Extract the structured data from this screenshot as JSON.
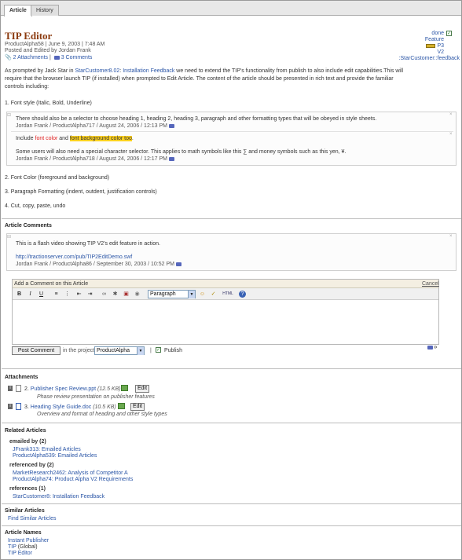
{
  "tabs": [
    "Article",
    "History"
  ],
  "article": {
    "title": "TIP Editor",
    "meta1": "ProductAlpha58 | June 9, 2003 | 7:48 AM",
    "meta2": "Posted and Edited by Jordan Frank",
    "attachments_link": "2 Attachments",
    "comments_link": "3 Comments",
    "status": {
      "done": "done",
      "feature": "Feature",
      "p3": "P3",
      "v2": "V2",
      "feedback": ":StarCustomer::feedback"
    },
    "body_p1_a": "As prompted by Jack Star in ",
    "body_p1_link1": "StarCustomer8.02",
    "body_p1_sep": ": ",
    "body_p1_link2": "Installation Feedback",
    "body_p1_b": " we need to extend the TIP's functionality from publish to also include edit capabilities.This will",
    "body_p1_line2": "require that the browser launch TIP (if installed) when prompted to Edit Article. The content of the article should be presented in rich text and provide the familiar",
    "body_p1_line3": "controls including:",
    "item1": "1. Font style (Italic, Bold, Underline)",
    "inline_comment1": {
      "text": "There should also be a selector to choose heading 1, heading 2, heading 3, paragraph and other formatting types that will be obeyed in style sheets.",
      "byline": "Jordan Frank / ProductAlpha717 / August 24, 2006 / 12:13 PM"
    },
    "inline_comment2": {
      "include": "Include ",
      "font_color": "font color",
      "and": " and ",
      "bg_color": "font background color too",
      "period": ".",
      "text2": "Some users will also need a special character selector. This applies to math symbols like this ∑ and money symbols such as this yen, ¥.",
      "byline": "Jordan Frank / ProductAlpha718 / August 24, 2006 / 12:17 PM"
    },
    "item2": "2. Font Color (foreground and background)",
    "item3": "3. Paragraph Formatting (indent, outdent, justification controls)",
    "item4": "4. Cut, copy, paste, undo"
  },
  "comments": {
    "header": "Article Comments",
    "c1_text": "This is a flash video showing TIP V2's edit feature in action.",
    "c1_link": "http://tractionserver.com/pub/TIP2EditDemo.swf",
    "c1_byline": "Jordan Frank / ProductAlpha86 / September 30, 2003 / 10:52 PM"
  },
  "editor": {
    "add_label": "Add a Comment on this Article",
    "cancel": "Cancel",
    "toolbar": [
      "B",
      "I",
      "U"
    ],
    "format_value": "Paragraph",
    "html_label": "HTML",
    "post_button": "Post Comment",
    "in_project": "in the project",
    "project_value": "ProductAlpha",
    "pipe": "|",
    "publish": "Publish"
  },
  "attachments": {
    "header": "Attachments",
    "items": [
      {
        "num": "2.",
        "name": "Publisher Spec Review.ppt",
        "size": "(12.5 KB)",
        "edit": "Edit",
        "desc": "Phase review presentation on publisher features"
      },
      {
        "num": "3.",
        "name": "Heading Style Guide.doc",
        "size": "(10.5 KB)",
        "edit": "Edit",
        "desc": "Overview and format of heading and other style types"
      }
    ]
  },
  "related": {
    "header": "Related Articles",
    "emailed_by": "emailed by (2)",
    "emailed": [
      "JFrank313: Emailed Articles",
      "ProductAlpha539: Emailed Articles"
    ],
    "referenced_by": "referenced by (2)",
    "refs_by": [
      "MarketResearch2462: Analysis of Competitor A",
      "ProductAlpha74: Product Alpha V2 Requirements"
    ],
    "references": "references (1)",
    "refs": [
      "StarCustomer8: Installation Feedback"
    ]
  },
  "similar": {
    "header": "Similar Articles",
    "link": "Find Similar Articles"
  },
  "names": {
    "header": "Article Names",
    "n1": "Instant Publisher",
    "n2_link": "TIP",
    "n2_rest": " (Global)",
    "n3": "TIP Editor"
  }
}
